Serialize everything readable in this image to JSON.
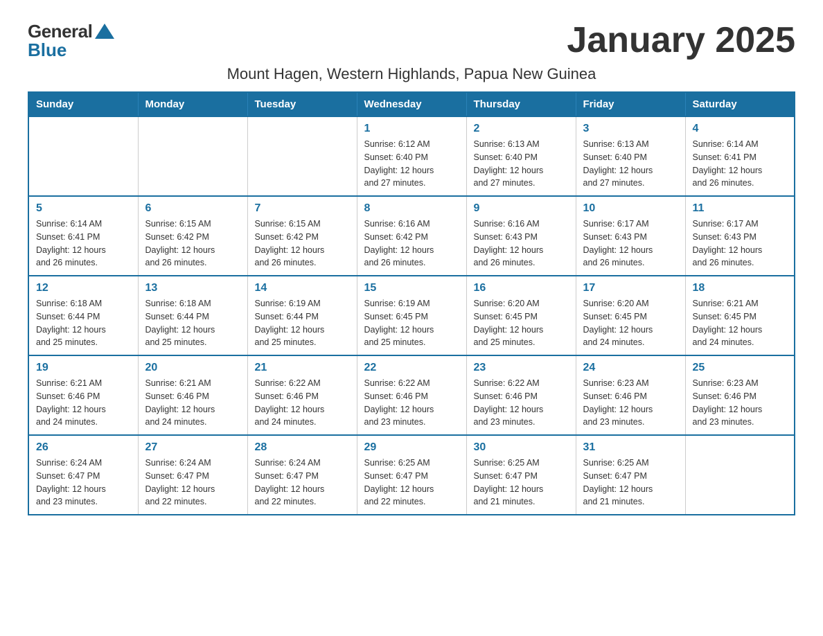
{
  "header": {
    "logo_general": "General",
    "logo_blue": "Blue",
    "title": "January 2025",
    "subtitle": "Mount Hagen, Western Highlands, Papua New Guinea"
  },
  "calendar": {
    "days_of_week": [
      "Sunday",
      "Monday",
      "Tuesday",
      "Wednesday",
      "Thursday",
      "Friday",
      "Saturday"
    ],
    "weeks": [
      [
        {
          "day": "",
          "info": ""
        },
        {
          "day": "",
          "info": ""
        },
        {
          "day": "",
          "info": ""
        },
        {
          "day": "1",
          "info": "Sunrise: 6:12 AM\nSunset: 6:40 PM\nDaylight: 12 hours\nand 27 minutes."
        },
        {
          "day": "2",
          "info": "Sunrise: 6:13 AM\nSunset: 6:40 PM\nDaylight: 12 hours\nand 27 minutes."
        },
        {
          "day": "3",
          "info": "Sunrise: 6:13 AM\nSunset: 6:40 PM\nDaylight: 12 hours\nand 27 minutes."
        },
        {
          "day": "4",
          "info": "Sunrise: 6:14 AM\nSunset: 6:41 PM\nDaylight: 12 hours\nand 26 minutes."
        }
      ],
      [
        {
          "day": "5",
          "info": "Sunrise: 6:14 AM\nSunset: 6:41 PM\nDaylight: 12 hours\nand 26 minutes."
        },
        {
          "day": "6",
          "info": "Sunrise: 6:15 AM\nSunset: 6:42 PM\nDaylight: 12 hours\nand 26 minutes."
        },
        {
          "day": "7",
          "info": "Sunrise: 6:15 AM\nSunset: 6:42 PM\nDaylight: 12 hours\nand 26 minutes."
        },
        {
          "day": "8",
          "info": "Sunrise: 6:16 AM\nSunset: 6:42 PM\nDaylight: 12 hours\nand 26 minutes."
        },
        {
          "day": "9",
          "info": "Sunrise: 6:16 AM\nSunset: 6:43 PM\nDaylight: 12 hours\nand 26 minutes."
        },
        {
          "day": "10",
          "info": "Sunrise: 6:17 AM\nSunset: 6:43 PM\nDaylight: 12 hours\nand 26 minutes."
        },
        {
          "day": "11",
          "info": "Sunrise: 6:17 AM\nSunset: 6:43 PM\nDaylight: 12 hours\nand 26 minutes."
        }
      ],
      [
        {
          "day": "12",
          "info": "Sunrise: 6:18 AM\nSunset: 6:44 PM\nDaylight: 12 hours\nand 25 minutes."
        },
        {
          "day": "13",
          "info": "Sunrise: 6:18 AM\nSunset: 6:44 PM\nDaylight: 12 hours\nand 25 minutes."
        },
        {
          "day": "14",
          "info": "Sunrise: 6:19 AM\nSunset: 6:44 PM\nDaylight: 12 hours\nand 25 minutes."
        },
        {
          "day": "15",
          "info": "Sunrise: 6:19 AM\nSunset: 6:45 PM\nDaylight: 12 hours\nand 25 minutes."
        },
        {
          "day": "16",
          "info": "Sunrise: 6:20 AM\nSunset: 6:45 PM\nDaylight: 12 hours\nand 25 minutes."
        },
        {
          "day": "17",
          "info": "Sunrise: 6:20 AM\nSunset: 6:45 PM\nDaylight: 12 hours\nand 24 minutes."
        },
        {
          "day": "18",
          "info": "Sunrise: 6:21 AM\nSunset: 6:45 PM\nDaylight: 12 hours\nand 24 minutes."
        }
      ],
      [
        {
          "day": "19",
          "info": "Sunrise: 6:21 AM\nSunset: 6:46 PM\nDaylight: 12 hours\nand 24 minutes."
        },
        {
          "day": "20",
          "info": "Sunrise: 6:21 AM\nSunset: 6:46 PM\nDaylight: 12 hours\nand 24 minutes."
        },
        {
          "day": "21",
          "info": "Sunrise: 6:22 AM\nSunset: 6:46 PM\nDaylight: 12 hours\nand 24 minutes."
        },
        {
          "day": "22",
          "info": "Sunrise: 6:22 AM\nSunset: 6:46 PM\nDaylight: 12 hours\nand 23 minutes."
        },
        {
          "day": "23",
          "info": "Sunrise: 6:22 AM\nSunset: 6:46 PM\nDaylight: 12 hours\nand 23 minutes."
        },
        {
          "day": "24",
          "info": "Sunrise: 6:23 AM\nSunset: 6:46 PM\nDaylight: 12 hours\nand 23 minutes."
        },
        {
          "day": "25",
          "info": "Sunrise: 6:23 AM\nSunset: 6:46 PM\nDaylight: 12 hours\nand 23 minutes."
        }
      ],
      [
        {
          "day": "26",
          "info": "Sunrise: 6:24 AM\nSunset: 6:47 PM\nDaylight: 12 hours\nand 23 minutes."
        },
        {
          "day": "27",
          "info": "Sunrise: 6:24 AM\nSunset: 6:47 PM\nDaylight: 12 hours\nand 22 minutes."
        },
        {
          "day": "28",
          "info": "Sunrise: 6:24 AM\nSunset: 6:47 PM\nDaylight: 12 hours\nand 22 minutes."
        },
        {
          "day": "29",
          "info": "Sunrise: 6:25 AM\nSunset: 6:47 PM\nDaylight: 12 hours\nand 22 minutes."
        },
        {
          "day": "30",
          "info": "Sunrise: 6:25 AM\nSunset: 6:47 PM\nDaylight: 12 hours\nand 21 minutes."
        },
        {
          "day": "31",
          "info": "Sunrise: 6:25 AM\nSunset: 6:47 PM\nDaylight: 12 hours\nand 21 minutes."
        },
        {
          "day": "",
          "info": ""
        }
      ]
    ]
  }
}
